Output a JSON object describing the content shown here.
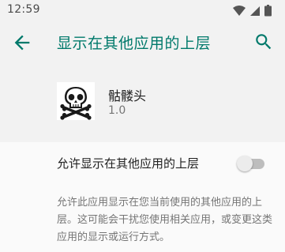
{
  "status_bar": {
    "time": "12:59",
    "icons": [
      "wifi-icon",
      "cell-signal-icon",
      "battery-icon"
    ]
  },
  "app_bar": {
    "title": "显示在其他应用的上层",
    "back_icon": "arrow-back-icon",
    "search_icon": "search-icon",
    "accent_color": "#00796b"
  },
  "app": {
    "name": "骷髅头",
    "version": "1.0",
    "icon": "skull-crossbones-icon"
  },
  "preference": {
    "title": "允许显示在其他应用的上层",
    "enabled": false,
    "summary": "允许此应用显示在您当前使用的其他应用的上层。这可能会干扰您使用相关应用，或变更这类应用的显示或运行方式。"
  }
}
